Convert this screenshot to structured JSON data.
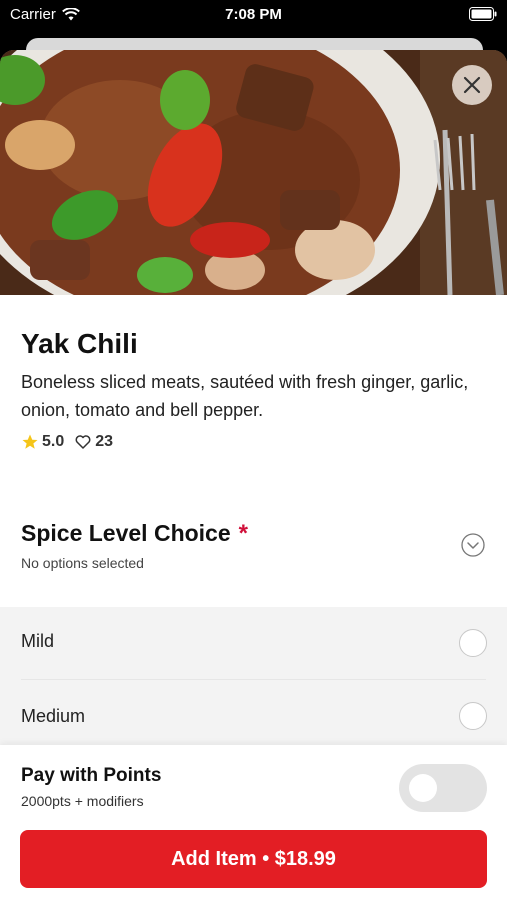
{
  "status_bar": {
    "carrier": "Carrier",
    "time": "7:08 PM"
  },
  "item": {
    "name": "Yak Chili",
    "description": "Boneless sliced meats, sautéed with fresh ginger, garlic, onion, tomato and bell pepper.",
    "rating": "5.0",
    "likes": "23",
    "image_icon": "food-photo"
  },
  "spice_section": {
    "title": "Spice Level Choice",
    "required_marker": "*",
    "subtitle": "No options selected",
    "options": [
      {
        "label": "Mild",
        "selected": false
      },
      {
        "label": "Medium",
        "selected": false
      }
    ]
  },
  "points": {
    "title": "Pay with Points",
    "subtitle": "2000pts + modifiers",
    "enabled": false
  },
  "add_button": {
    "label": "Add Item • $18.99"
  },
  "colors": {
    "accent": "#e31e24",
    "required": "#d0103a",
    "star": "#f5c518"
  }
}
